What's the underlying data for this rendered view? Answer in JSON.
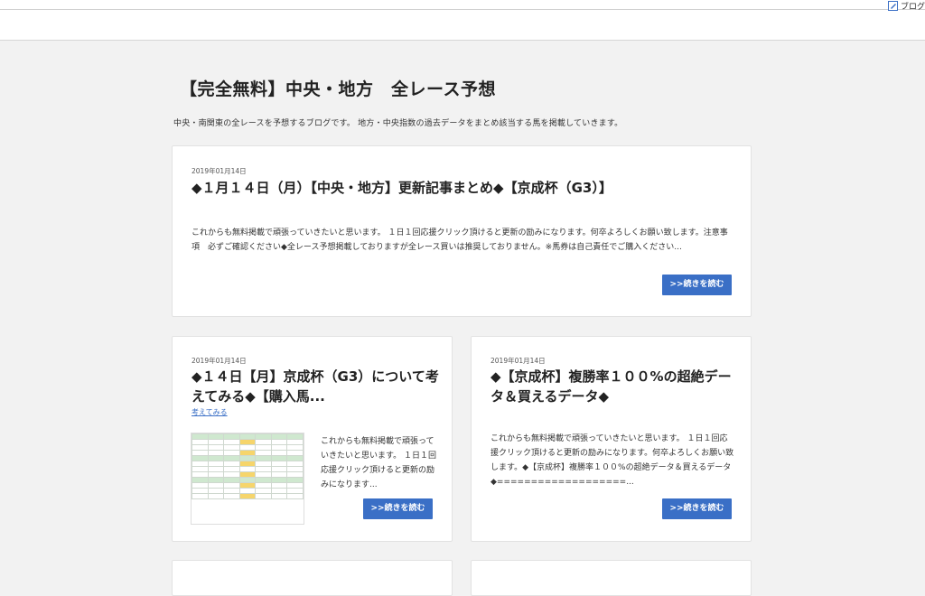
{
  "header": {
    "blog_link_label": "ブログ"
  },
  "site": {
    "title": "【完全無料】中央・地方　全レース予想",
    "description": "中央・南関東の全レースを予想するブログです。 地方・中央指数の過去データをまとめ該当する馬を掲載していきます。"
  },
  "posts": [
    {
      "date": "2019年01月14日",
      "title": "◆１月１４日（月）【中央・地方】更新記事まとめ◆【京成杯（G3）】",
      "excerpt": "これからも無料掲載で頑張っていきたいと思います。 １日１回応援クリック頂けると更新の励みになります。何卒よろしくお願い致します。注意事項　必ずご確認ください◆全レース予想掲載しておりますが全レース買いは推奨しておりません。※馬券は自己責任でご購入ください...",
      "read_more": ">>続きを読む"
    },
    {
      "date": "2019年01月14日",
      "title": "◆１４日【月】京成杯（G3）について考えてみる◆【購入馬...",
      "tag": "考えてみる",
      "excerpt": "これからも無料掲載で頑張っていきたいと思います。 １日１回応援クリック頂けると更新の励みになります...",
      "read_more": ">>続きを読む"
    },
    {
      "date": "2019年01月14日",
      "title": "◆【京成杯】複勝率１００%の超絶データ＆買えるデータ◆",
      "excerpt": "これからも無料掲載で頑張っていきたいと思います。 １日１回応援クリック頂けると更新の励みになります。何卒よろしくお願い致します。◆【京成杯】複勝率１００%の超絶データ＆買えるデータ◆===================...",
      "read_more": ">>続きを読む"
    }
  ]
}
